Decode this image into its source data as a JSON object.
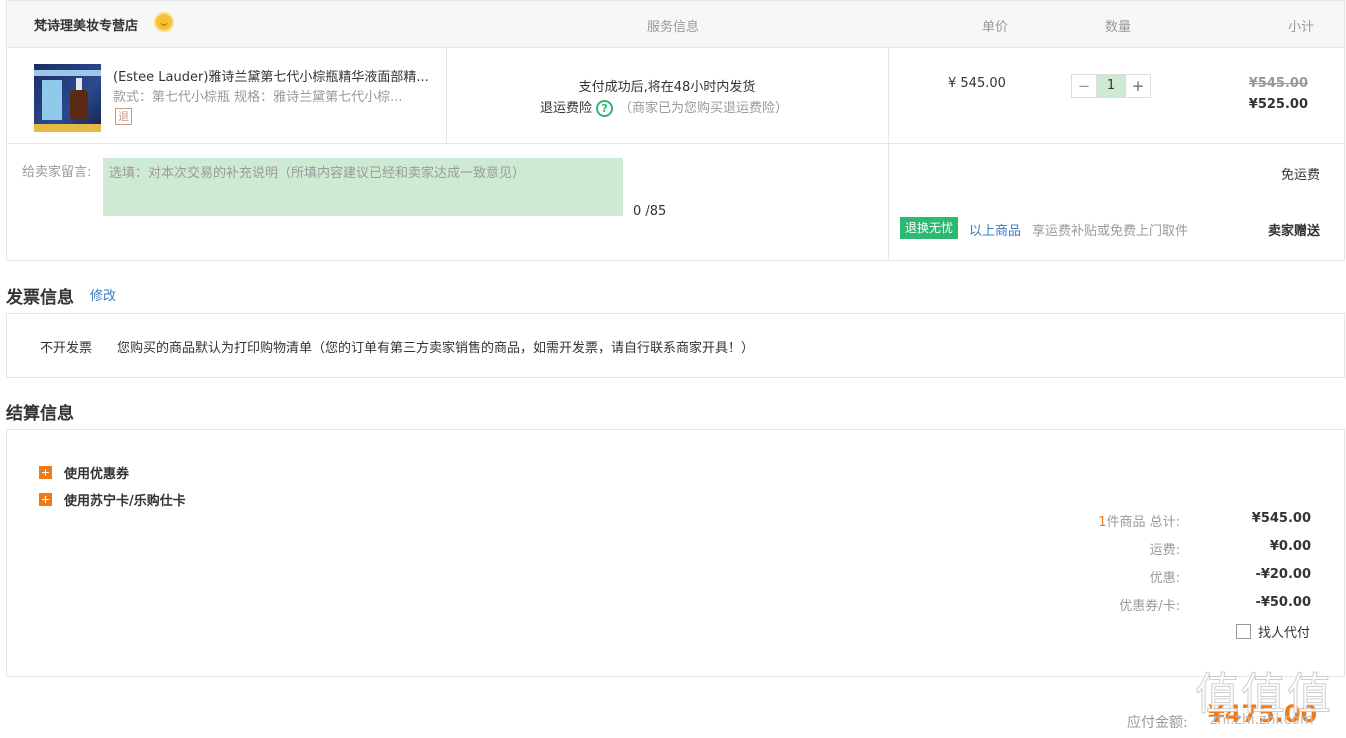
{
  "store": {
    "name": "梵诗理美妆专营店",
    "badge_icon": "gold-medal-icon"
  },
  "columns": {
    "service": "服务信息",
    "unit_price": "单价",
    "quantity": "数量",
    "subtotal": "小计"
  },
  "product": {
    "title": "(Estee Lauder)雅诗兰黛第七代小棕瓶精华液面部精...",
    "spec": "款式：第七代小棕瓶   规格：雅诗兰黛第七代小棕...",
    "return_icon_text": "退",
    "ship_note": "支付成功后,将在48小时内发货",
    "insurance_label": "退运费险",
    "insurance_note": "（商家已为您购买退运费险）",
    "unit_price": "¥ 545.00",
    "qty": "1",
    "qty_minus": "−",
    "qty_plus": "+",
    "subtotal_old": "¥545.00",
    "subtotal_new": "¥525.00"
  },
  "message": {
    "label": "给卖家留言:",
    "placeholder": "选填：对本次交易的补充说明（所填内容建议已经和卖家达成一致意见）",
    "value": "",
    "count": "0 /85"
  },
  "shipping": {
    "free": "免运费",
    "badge": "退换无忧",
    "above_items": "以上商品",
    "benefit": "享运费补贴或免费上门取件",
    "gift": "卖家赠送"
  },
  "invoice": {
    "title": "发票信息",
    "edit": "修改",
    "type": "不开发票",
    "desc": "您购买的商品默认为打印购物清单（您的订单有第三方卖家销售的商品，如需开发票，请自行联系商家开具！）"
  },
  "settlement": {
    "title": "结算信息",
    "options": [
      "使用优惠券",
      "使用苏宁卡/乐购仕卡"
    ],
    "item_count": "1",
    "total_label": "件商品 总计:",
    "total": "¥545.00",
    "freight_label": "运费:",
    "freight": "¥0.00",
    "discount_label": "优惠:",
    "discount": "-¥20.00",
    "coupon_label": "优惠券/卡:",
    "coupon": "-¥50.00",
    "proxy_pay": "找人代付",
    "pay_label": "应付金额:",
    "pay_value": "¥475.00"
  },
  "watermark": {
    "text": "值值值",
    "sub": "zhi.zhi.zhi.com"
  },
  "colors": {
    "accent": "#f07a1a",
    "link": "#3a7cc0",
    "green": "#2eb872",
    "input_bg": "#cfead2"
  }
}
